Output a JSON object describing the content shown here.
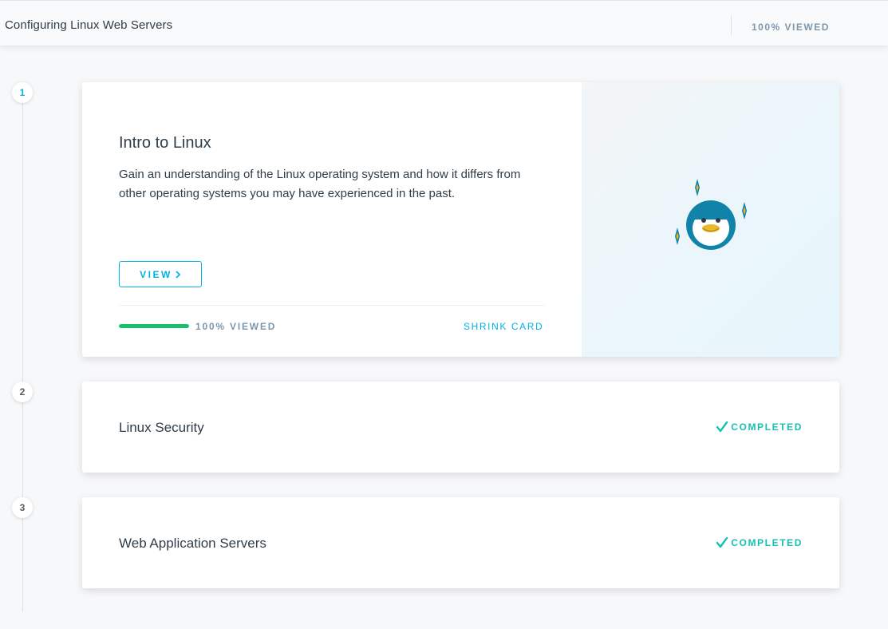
{
  "header": {
    "course_title": "Configuring Linux Web Servers",
    "progress_label": "100% VIEWED"
  },
  "lessons": [
    {
      "number": "1",
      "title": "Intro to Linux",
      "description": "Gain an understanding of the Linux operating system and how it differs from other operating systems you may have experienced in the past.",
      "view_label": "VIEW",
      "progress_fraction": 1.0,
      "viewed_label": "100% VIEWED",
      "shrink_label": "SHRINK CARD",
      "image_icon": "penguin-icon"
    },
    {
      "number": "2",
      "title": "Linux Security",
      "status_label": "COMPLETED",
      "status_icon": "checkmark-icon"
    },
    {
      "number": "3",
      "title": "Web Application Servers",
      "status_label": "COMPLETED",
      "status_icon": "checkmark-icon"
    }
  ],
  "colors": {
    "accent": "#02b3e4",
    "progress_green": "#15c26b",
    "completed_teal": "#15c2b0",
    "penguin_blue": "#1183a8"
  }
}
